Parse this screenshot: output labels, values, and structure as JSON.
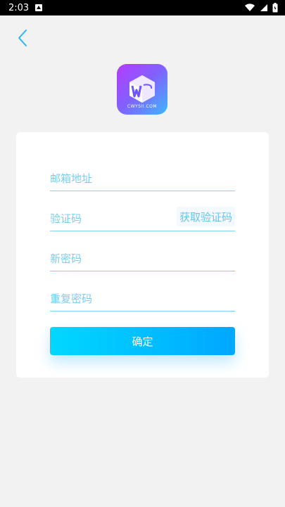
{
  "status_bar": {
    "time": "2:03"
  },
  "logo": {
    "text": "CWYSII.COM"
  },
  "form": {
    "email_placeholder": "邮箱地址",
    "code_placeholder": "验证码",
    "get_code_label": "获取验证码",
    "new_password_placeholder": "新密码",
    "repeat_password_placeholder": "重复密码",
    "submit_label": "确定"
  },
  "colors": {
    "accent": "#00b7ff",
    "placeholder": "#7dcdea",
    "divider": "#7dd3f0",
    "background": "#f2f2f2"
  },
  "icons": {
    "back": "chevron-left-icon",
    "wifi": "wifi-icon",
    "cell": "cell-signal-icon",
    "battery": "battery-icon",
    "notification": "notification-icon"
  }
}
